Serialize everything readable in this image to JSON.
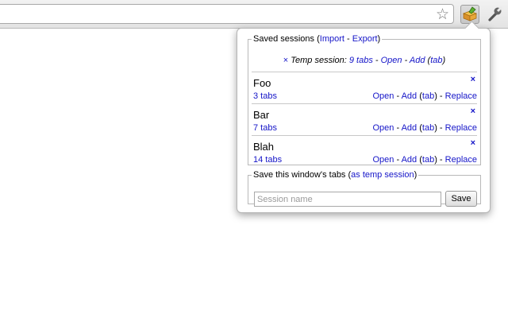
{
  "browser": {
    "bookmark_icon": "star-icon",
    "extension_icon": "session-box-icon",
    "menu_icon": "wrench-icon"
  },
  "popup": {
    "saved": {
      "legend": "Saved sessions",
      "import_label": "Import",
      "export_label": "Export",
      "sep": " - "
    },
    "temp": {
      "close_glyph": "×",
      "label": "Temp session:",
      "tabs": "9 tabs",
      "open": "Open",
      "add": "Add",
      "tab": "tab"
    },
    "sessions": [
      {
        "name": "Foo",
        "tabs": "3 tabs",
        "open": "Open",
        "add": "Add",
        "tab": "tab",
        "replace": "Replace",
        "close": "×"
      },
      {
        "name": "Bar",
        "tabs": "7 tabs",
        "open": "Open",
        "add": "Add",
        "tab": "tab",
        "replace": "Replace",
        "close": "×"
      },
      {
        "name": "Blah",
        "tabs": "14 tabs",
        "open": "Open",
        "add": "Add",
        "tab": "tab",
        "replace": "Replace",
        "close": "×"
      }
    ],
    "save": {
      "legend": "Save this window's tabs",
      "temp_link": "as temp session",
      "placeholder": "Session name",
      "value": "",
      "button": "Save"
    }
  },
  "colors": {
    "link": "#1515c8",
    "border": "#b9b9b9"
  }
}
